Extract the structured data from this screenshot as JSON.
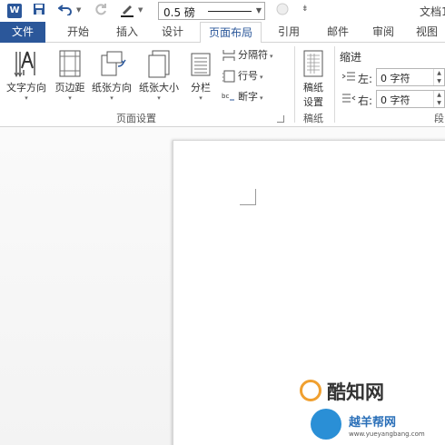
{
  "quick_access": {
    "line_weight": "0.5 磅",
    "doc_title": "文档1"
  },
  "tabs": [
    {
      "label": "文件"
    },
    {
      "label": "开始"
    },
    {
      "label": "插入"
    },
    {
      "label": "设计"
    },
    {
      "label": "页面布局"
    },
    {
      "label": "引用"
    },
    {
      "label": "邮件"
    },
    {
      "label": "审阅"
    },
    {
      "label": "视图"
    }
  ],
  "page_setup": {
    "text_direction": "文字方向",
    "margins": "页边距",
    "orientation": "纸张方向",
    "size": "纸张大小",
    "columns": "分栏",
    "breaks": "分隔符",
    "line_numbers": "行号",
    "hyphenation": "断字",
    "group_label": "页面设置"
  },
  "manuscript": {
    "button_line1": "稿纸",
    "button_line2": "设置",
    "group_label": "稿纸"
  },
  "indent": {
    "heading": "缩进",
    "left_label": "左:",
    "left_value": "0 字符",
    "right_label": "右:",
    "right_value": "0 字符"
  },
  "paragraph": {
    "group_label": "段"
  },
  "watermark": {
    "site1": "酷知网",
    "site2": "越羊帮网",
    "url": "www.yueyangbang.com"
  },
  "colors": {
    "accent": "#2b579a",
    "ribbon_bg": "#ffffff",
    "canvas_bg": "#f5f5f5"
  }
}
